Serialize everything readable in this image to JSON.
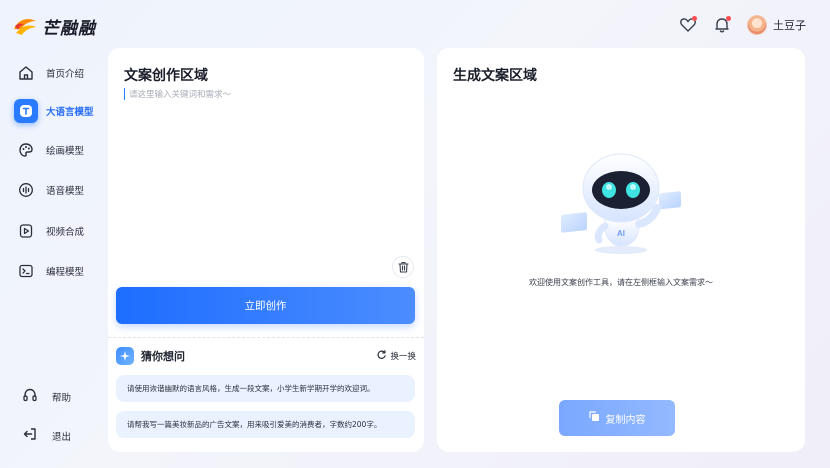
{
  "app": {
    "name": "芒融融",
    "user_name": "土豆子",
    "accent_color": "#2a7bff"
  },
  "sidebar": {
    "items": [
      {
        "label": "首页介绍",
        "icon": "home-icon",
        "active": false
      },
      {
        "label": "大语言模型",
        "icon": "llm-icon",
        "active": true
      },
      {
        "label": "绘画模型",
        "icon": "palette-icon",
        "active": false
      },
      {
        "label": "语音模型",
        "icon": "audio-wave-icon",
        "active": false
      },
      {
        "label": "视频合成",
        "icon": "video-icon",
        "active": false
      },
      {
        "label": "编程模型",
        "icon": "terminal-icon",
        "active": false
      }
    ],
    "help_label": "帮助",
    "logout_label": "退出"
  },
  "left_panel": {
    "title": "文案创作区域",
    "input_placeholder": "请这里输入关键词和需求～",
    "input_value": "",
    "create_button": "立即创作",
    "guess_title": "猜你想问",
    "refresh_label": "换一换",
    "suggestions": [
      "请使用诙谐幽默的语言风格，生成一段文案，小学生新学期开学的欢迎词。",
      "请帮我写一篇美妆新品的广告文案，用来吸引爱美的消费者，字数约200字。"
    ]
  },
  "right_panel": {
    "title": "生成文案区域",
    "welcome_text": "欢迎使用文案创作工具，请在左侧框输入文案需求～",
    "copy_button": "复制内容",
    "robot_badge": "AI"
  }
}
